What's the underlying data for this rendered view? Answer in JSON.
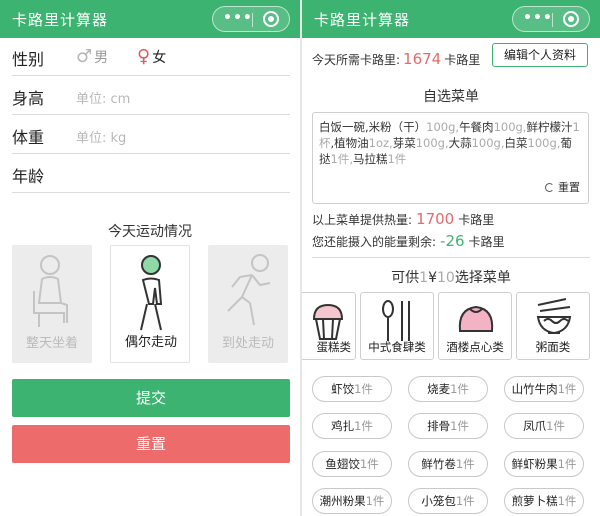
{
  "left": {
    "app_title": "卡路里计算器",
    "gender_label": "性别",
    "male_label": "男",
    "female_label": "女",
    "height_label": "身高",
    "height_placeholder": "单位: cm",
    "weight_label": "体重",
    "weight_placeholder": "单位: kg",
    "age_label": "年龄",
    "activity_title": "今天运动情况",
    "activities": [
      "整天坐着",
      "偶尔走动",
      "到处走动"
    ],
    "submit_label": "提交",
    "reset_label": "重置"
  },
  "right": {
    "app_title": "卡路里计算器",
    "required_prefix": "今天所需卡路里:",
    "required_value": "1674",
    "required_unit": "卡路里",
    "edit_profile_label": "编辑个人资料",
    "custom_menu_title": "自选菜单",
    "menu_items": [
      {
        "name": "白饭一碗,",
        "qty": ""
      },
      {
        "name": "米粉（干）",
        "qty": "100g,"
      },
      {
        "name": "午餐肉",
        "qty": "100g,"
      },
      {
        "name": "鲜柠檬汁",
        "qty": "1杯"
      },
      {
        "name": ",植物油",
        "qty": "1oz,"
      },
      {
        "name": "芽菜",
        "qty": "100g,"
      },
      {
        "name": "大蒜",
        "qty": "100g,"
      },
      {
        "name": "白菜",
        "qty": "100g,"
      },
      {
        "name": "葡挞",
        "qty": "1件,"
      },
      {
        "name": "马拉糕",
        "qty": "1件"
      }
    ],
    "menu_reset_label": "重置",
    "provided_prefix": "以上菜单提供热量:",
    "provided_value": "1700",
    "provided_unit": "卡路里",
    "remaining_prefix": "您还能摄入的能量剩余:",
    "remaining_value": "-26",
    "remaining_unit": "卡路里",
    "offer_prefix": "可供",
    "offer_count": "1",
    "offer_mid": "¥",
    "offer_price": "10",
    "offer_suffix": "选择菜单",
    "categories": [
      "蛋糕类",
      "中式食肆类",
      "酒楼点心类",
      "粥面类"
    ],
    "dishes": [
      {
        "name": "虾饺",
        "count": "1件"
      },
      {
        "name": "烧麦",
        "count": "1件"
      },
      {
        "name": "山竹牛肉",
        "count": "1件"
      },
      {
        "name": "鸡扎",
        "count": "1件"
      },
      {
        "name": "排骨",
        "count": "1件"
      },
      {
        "name": "凤爪",
        "count": "1件"
      },
      {
        "name": "鱼翅饺",
        "count": "1件"
      },
      {
        "name": "鲜竹卷",
        "count": "1件"
      },
      {
        "name": "鲜虾粉果",
        "count": "1件"
      },
      {
        "name": "潮州粉果",
        "count": "1件"
      },
      {
        "name": "小笼包",
        "count": "1件"
      },
      {
        "name": "煎萝卜糕",
        "count": "1件"
      }
    ]
  },
  "colors": {
    "brand_green": "#3cb371",
    "reset_red": "#ee6b6b",
    "value_red": "#e36b6b",
    "muted_gray": "#b8b8b8"
  }
}
